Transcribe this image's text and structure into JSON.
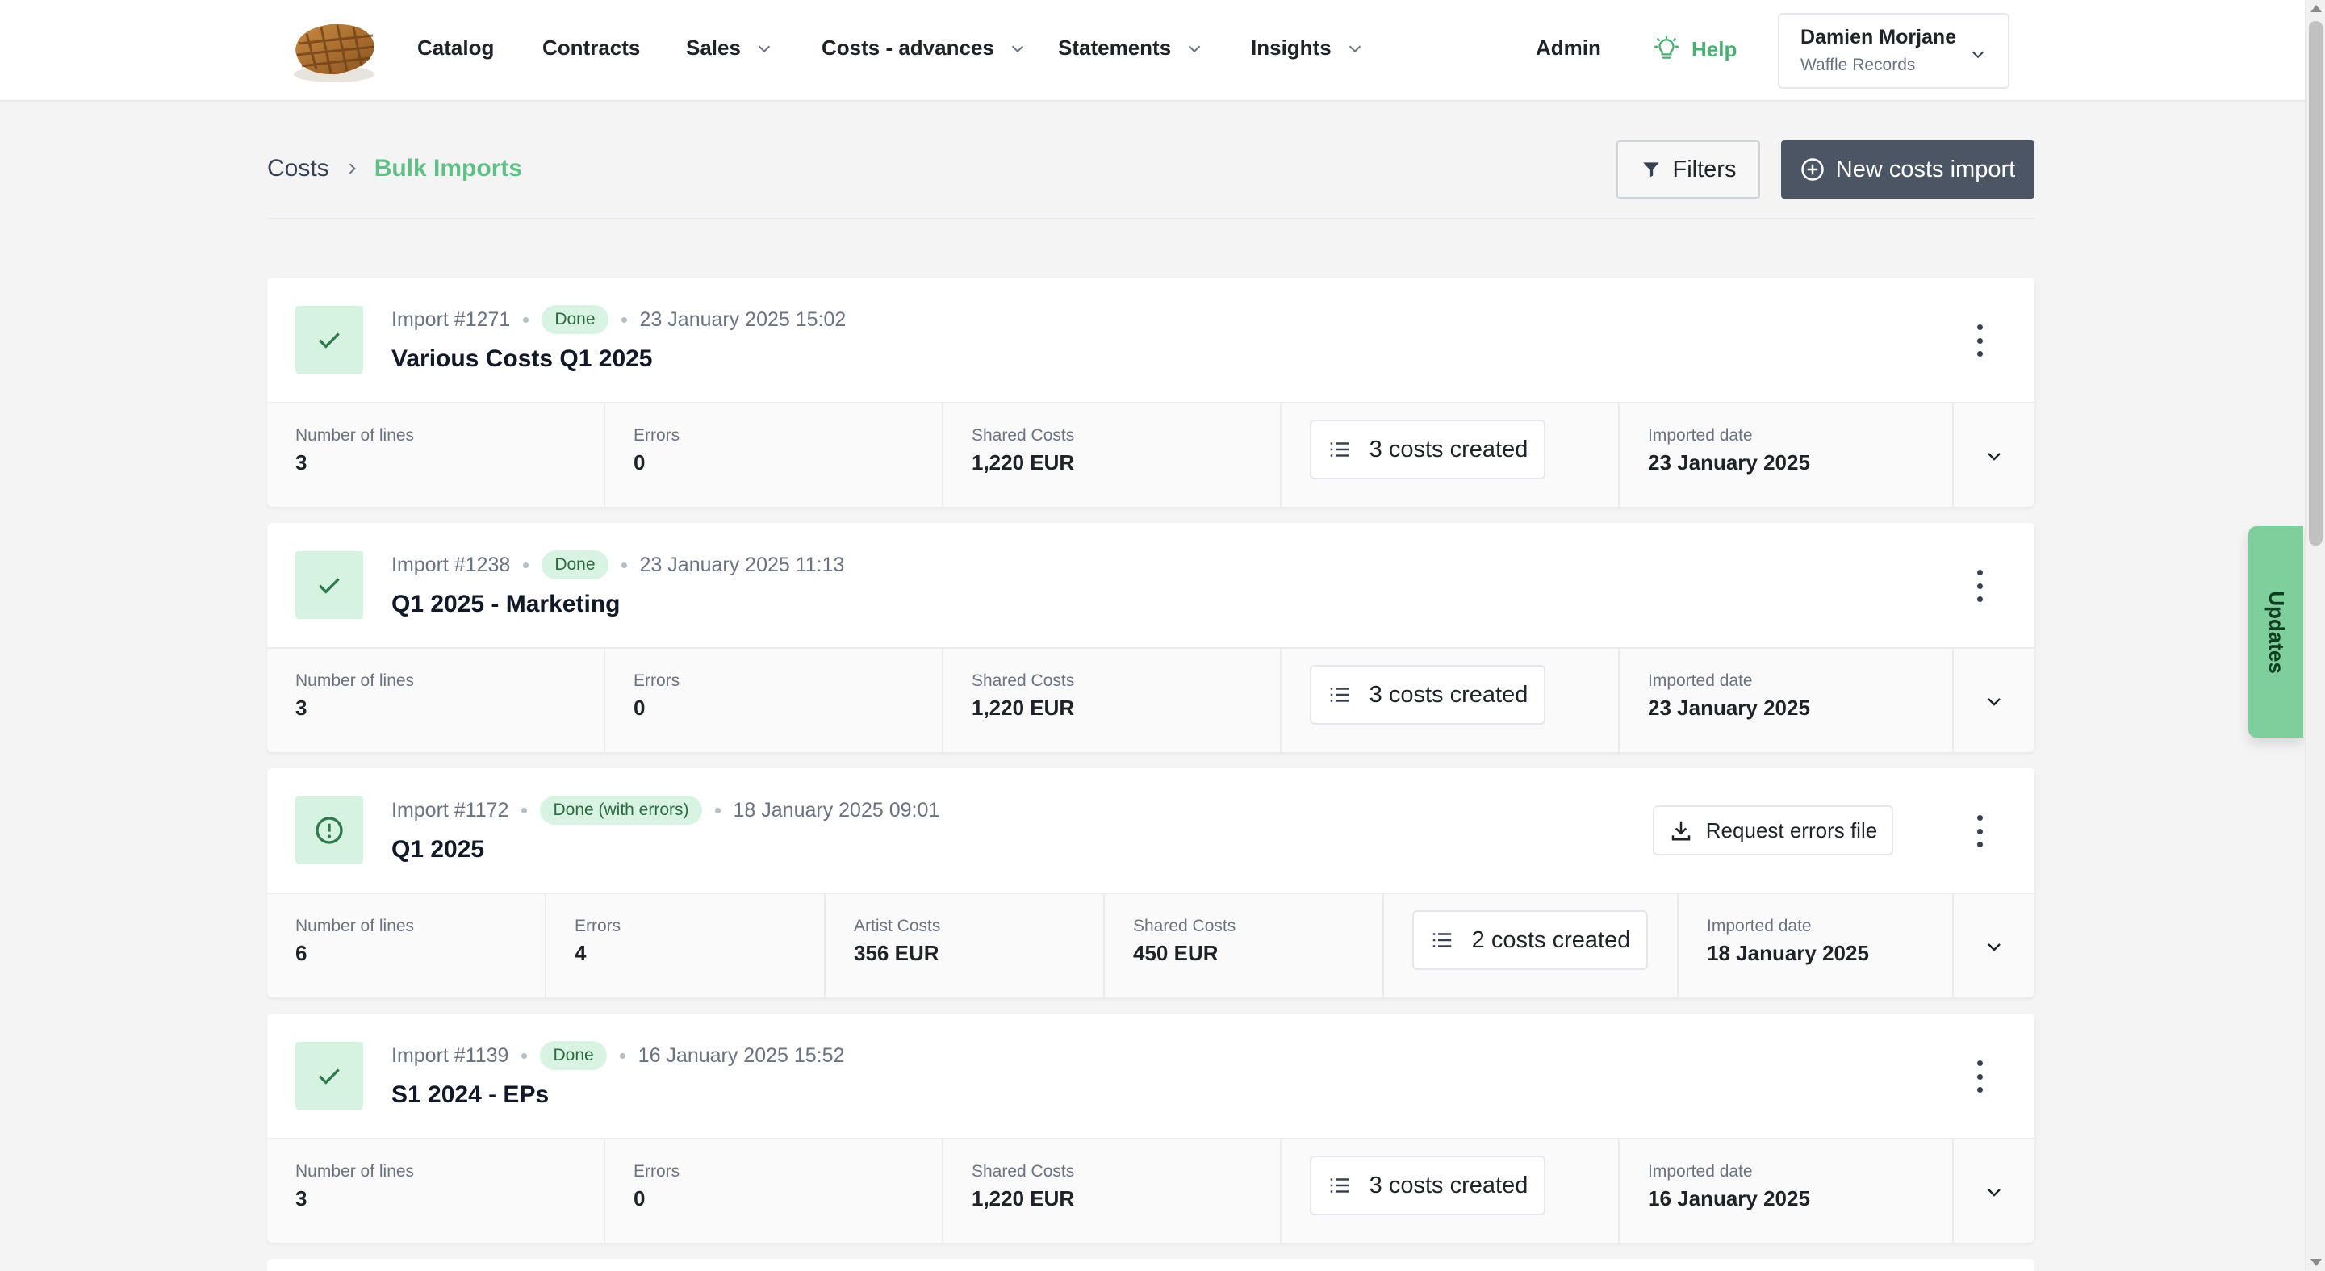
{
  "nav": {
    "items": [
      {
        "label": "Catalog",
        "dropdown": false
      },
      {
        "label": "Contracts",
        "dropdown": false
      },
      {
        "label": "Sales",
        "dropdown": true
      },
      {
        "label": "Costs - advances",
        "dropdown": true
      },
      {
        "label": "Statements",
        "dropdown": true
      },
      {
        "label": "Insights",
        "dropdown": true
      }
    ],
    "admin": "Admin",
    "help": "Help",
    "user": {
      "name": "Damien Morjane",
      "org": "Waffle Records"
    }
  },
  "breadcrumb": {
    "root": "Costs",
    "current": "Bulk Imports"
  },
  "toolbar": {
    "filters": "Filters",
    "new_import": "New costs import"
  },
  "updates_tab": "Updates",
  "labels": {
    "lines": "Number of lines",
    "errors": "Errors",
    "shared_costs": "Shared Costs",
    "artist_costs": "Artist Costs",
    "imported_date": "Imported date",
    "request_errors": "Request errors file"
  },
  "imports": [
    {
      "id": "Import #1271",
      "status": "Done",
      "datetime": "23 January 2025 15:02",
      "title": "Various Costs Q1 2025",
      "lines": "3",
      "errors": "0",
      "shared_costs": "1,220 EUR",
      "costs_created": "3 costs created",
      "imported_date": "23 January 2025"
    },
    {
      "id": "Import #1238",
      "status": "Done",
      "datetime": "23 January 2025 11:13",
      "title": "Q1 2025 - Marketing",
      "lines": "3",
      "errors": "0",
      "shared_costs": "1,220 EUR",
      "costs_created": "3 costs created",
      "imported_date": "23 January 2025"
    },
    {
      "id": "Import #1172",
      "status": "Done (with errors)",
      "datetime": "18 January 2025 09:01",
      "title": "Q1 2025",
      "lines": "6",
      "errors": "4",
      "artist_costs": "356 EUR",
      "shared_costs": "450 EUR",
      "costs_created": "2 costs created",
      "imported_date": "18 January 2025"
    },
    {
      "id": "Import #1139",
      "status": "Done",
      "datetime": "16 January 2025 15:52",
      "title": "S1 2024 - EPs",
      "lines": "3",
      "errors": "0",
      "shared_costs": "1,220 EUR",
      "costs_created": "3 costs created",
      "imported_date": "16 January 2025"
    }
  ],
  "colors": {
    "accent": "#5fbf87",
    "primary_button": "#4b5563",
    "badge_bg": "#d8f3e2",
    "status_box": "#d6f2e0"
  }
}
